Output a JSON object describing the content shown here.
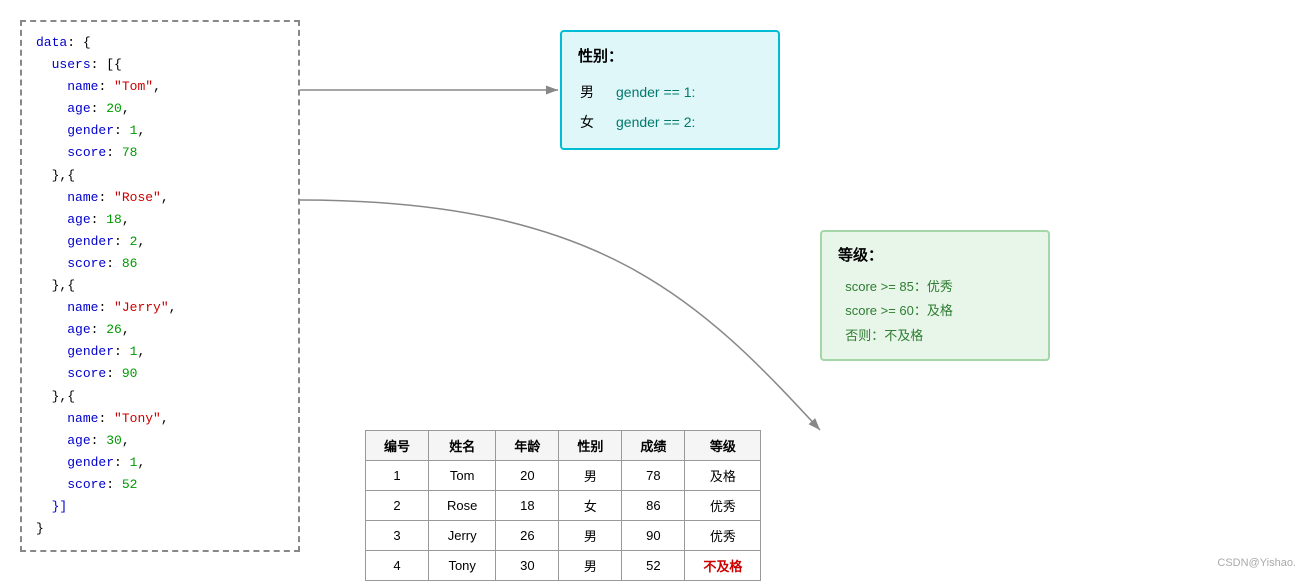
{
  "codeBox": {
    "lines": [
      {
        "text": "data: {",
        "type": "plain"
      },
      {
        "text": "  users: [{",
        "type": "plain"
      },
      {
        "indent": "    ",
        "key": "name",
        "value": "\"Tom\"",
        "comma": ","
      },
      {
        "indent": "    ",
        "key": "age",
        "value": "20",
        "comma": ","
      },
      {
        "indent": "    ",
        "key": "gender",
        "value": "1",
        "comma": ","
      },
      {
        "indent": "    ",
        "key": "score",
        "value": "78",
        "comma": ""
      },
      {
        "text": "  },{",
        "type": "plain"
      },
      {
        "indent": "    ",
        "key": "name",
        "value": "\"Rose\"",
        "comma": ","
      },
      {
        "indent": "    ",
        "key": "age",
        "value": "18",
        "comma": ","
      },
      {
        "indent": "    ",
        "key": "gender",
        "value": "2",
        "comma": ","
      },
      {
        "indent": "    ",
        "key": "score",
        "value": "86",
        "comma": ""
      },
      {
        "text": "  },{",
        "type": "plain"
      },
      {
        "indent": "    ",
        "key": "name",
        "value": "\"Jerry\"",
        "comma": ","
      },
      {
        "indent": "    ",
        "key": "age",
        "value": "26",
        "comma": ","
      },
      {
        "indent": "    ",
        "key": "gender",
        "value": "1",
        "comma": ","
      },
      {
        "indent": "    ",
        "key": "score",
        "value": "90",
        "comma": ""
      },
      {
        "text": "  },{",
        "type": "plain"
      },
      {
        "indent": "    ",
        "key": "name",
        "value": "\"Tony\"",
        "comma": ","
      },
      {
        "indent": "    ",
        "key": "age",
        "value": "30",
        "comma": ","
      },
      {
        "indent": "    ",
        "key": "gender",
        "value": "1",
        "comma": ","
      },
      {
        "indent": "    ",
        "key": "score",
        "value": "52",
        "comma": ""
      },
      {
        "text": "  }]",
        "type": "plain"
      },
      {
        "text": "}",
        "type": "plain"
      }
    ]
  },
  "genderTooltip": {
    "title": "性别：",
    "items": [
      {
        "label": "男",
        "condition": "gender == 1:"
      },
      {
        "label": "女",
        "condition": "gender == 2:"
      }
    ]
  },
  "gradeTooltip": {
    "title": "等级：",
    "items": [
      {
        "condition": "score >= 85：优秀"
      },
      {
        "condition": "score >= 60：及格"
      },
      {
        "condition": "否则：不及格"
      }
    ]
  },
  "table": {
    "headers": [
      "编号",
      "姓名",
      "年龄",
      "性别",
      "成绩",
      "等级"
    ],
    "rows": [
      {
        "id": "1",
        "name": "Tom",
        "age": "20",
        "gender": "男",
        "score": "78",
        "grade": "及格",
        "fail": false
      },
      {
        "id": "2",
        "name": "Rose",
        "age": "18",
        "gender": "女",
        "score": "86",
        "grade": "优秀",
        "fail": false
      },
      {
        "id": "3",
        "name": "Jerry",
        "age": "26",
        "gender": "男",
        "score": "90",
        "grade": "优秀",
        "fail": false
      },
      {
        "id": "4",
        "name": "Tony",
        "age": "30",
        "gender": "男",
        "score": "52",
        "grade": "不及格",
        "fail": true
      }
    ]
  },
  "watermark": "CSDN@Yishao."
}
